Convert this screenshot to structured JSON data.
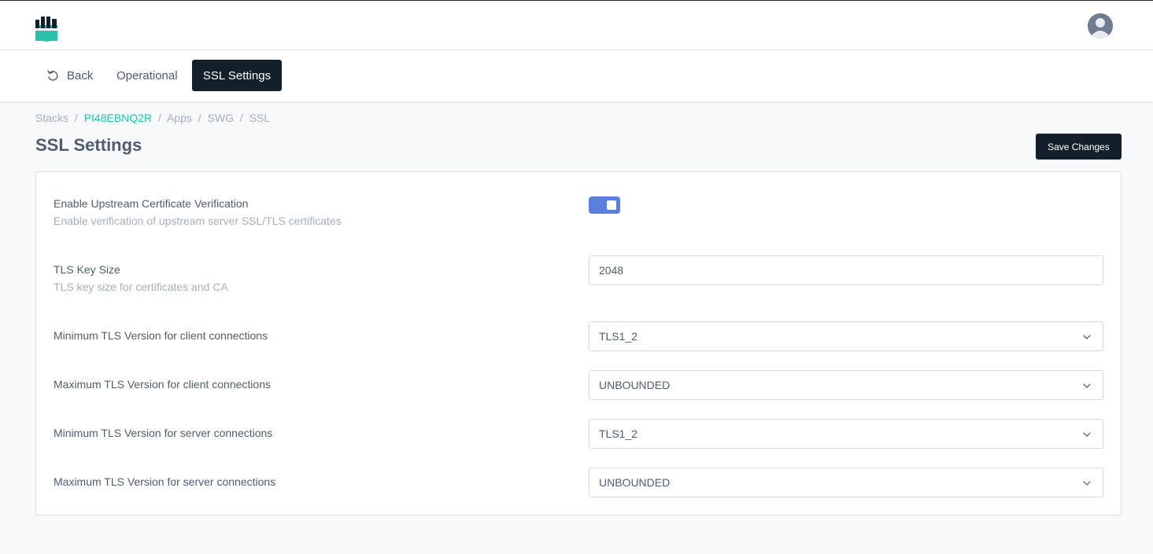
{
  "header": {
    "logo_icon": "shield-fist-logo",
    "avatar_icon": "user-avatar",
    "brand_color": "#2bc0a8"
  },
  "nav": {
    "back_label": "Back",
    "operational_label": "Operational",
    "ssl_label": "SSL Settings",
    "active_tab": "SSL Settings"
  },
  "breadcrumb": {
    "stacks": "Stacks",
    "sep": "/",
    "stack_id": "PI48EBNQ2R",
    "apps": "Apps",
    "swg": "SWG",
    "ssl": "SSL"
  },
  "page": {
    "title": "SSL Settings",
    "save_label": "Save Changes"
  },
  "settings": {
    "upstream": {
      "label": "Enable Upstream Certificate Verification",
      "description": "Enable verification of upstream server SSL/TLS certificates",
      "enabled": true,
      "toggle_color": "#5b7fdf"
    },
    "key_size": {
      "label": "TLS Key Size",
      "description": "TLS key size for certificates and CA",
      "value": "2048"
    },
    "min_client": {
      "label": "Minimum TLS Version for client connections",
      "value": "TLS1_2"
    },
    "max_client": {
      "label": "Maximum TLS Version for client connections",
      "value": "UNBOUNDED"
    },
    "min_server": {
      "label": "Minimum TLS Version for server connections",
      "value": "TLS1_2"
    },
    "max_server": {
      "label": "Maximum TLS Version for server connections",
      "value": "UNBOUNDED"
    }
  }
}
